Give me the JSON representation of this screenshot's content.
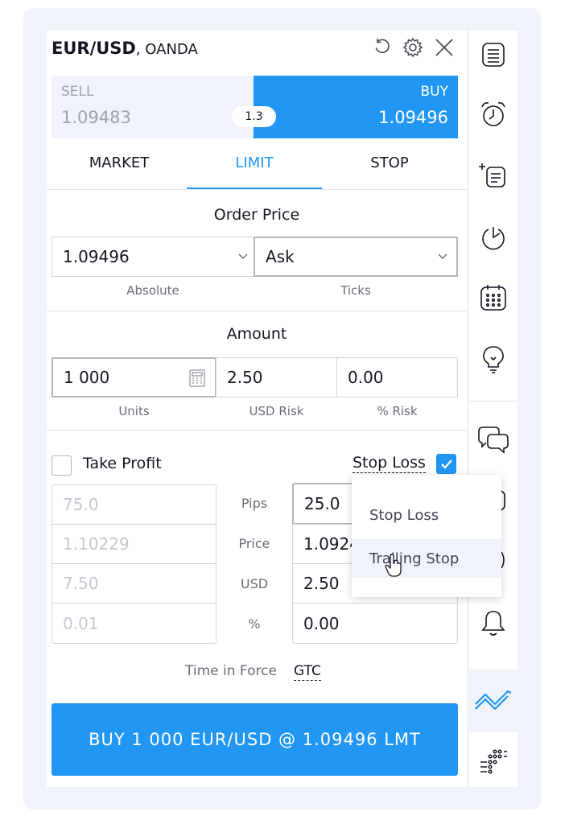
{
  "header": {
    "symbol": "EUR/USD",
    "broker": ", OANDA"
  },
  "sell": {
    "label": "SELL",
    "price": "1.09483"
  },
  "buy": {
    "label": "BUY",
    "price": "1.09496"
  },
  "spread": "1.3",
  "tabs": [
    {
      "label": "MARKET",
      "active": false
    },
    {
      "label": "LIMIT",
      "active": true
    },
    {
      "label": "STOP",
      "active": false
    }
  ],
  "order_price": {
    "title": "Order Price",
    "value": "1.09496",
    "mode": "Ask",
    "label_left": "Absolute",
    "label_right": "Ticks"
  },
  "amount": {
    "title": "Amount",
    "units": "1 000",
    "usd_risk": "2.50",
    "pct_risk": "0.00",
    "label_units": "Units",
    "label_usd_risk": "USD Risk",
    "label_pct_risk": "% Risk"
  },
  "take_profit": {
    "label": "Take Profit",
    "checked": false,
    "pips": "75.0",
    "price": "1.10229",
    "usd": "7.50",
    "pct": "0.01"
  },
  "row_labels": [
    "Pips",
    "Price",
    "USD",
    "%"
  ],
  "stop_loss": {
    "label": "Stop Loss",
    "checked": true,
    "pips": "25.0",
    "price": "1.0924",
    "usd": "2.50",
    "pct": "0.00"
  },
  "stop_loss_menu": {
    "items": [
      "Stop Loss",
      "Trailing Stop"
    ]
  },
  "time_in_force": {
    "label": "Time in Force",
    "value": "GTC"
  },
  "order_button": "BUY 1 000 EUR/USD @ 1.09496 LMT",
  "colors": {
    "accent": "#2196f3",
    "sell_bg": "#f0f3fa",
    "text": "#131722"
  },
  "sidebar_icons": [
    "watchlist-icon",
    "alarm-clock-icon",
    "hotlist-icon",
    "data-window-icon",
    "calendar-icon",
    "ideas-icon",
    "chats-icon",
    "streams-icon",
    "broadcast-icon",
    "notifications-icon",
    "trading-panel-icon",
    "dom-icon"
  ]
}
